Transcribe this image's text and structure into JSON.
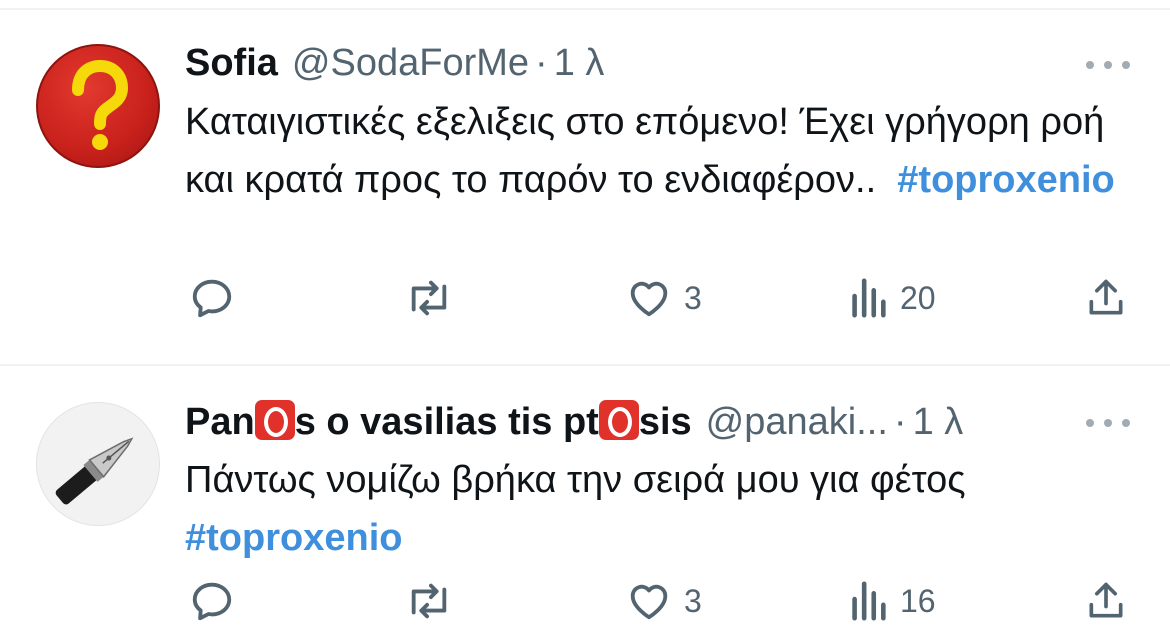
{
  "tweets": [
    {
      "name": "Sofia",
      "handle": "@SodaForMe",
      "separator": "·",
      "time": "1 λ",
      "text": "Καταιγιστικές εξελιξεις στο επόμενο! Έχει γρήγορη ροή και κρατά προς το παρόν το ενδιαφέρον..",
      "hashtag": "#toproxenio",
      "likes": "3",
      "views": "20"
    },
    {
      "name_parts": [
        "Pan",
        "s o vasilias tis pt",
        "sis"
      ],
      "handle": "@panaki...",
      "separator": "·",
      "time": "1 λ",
      "text": "Πάντως νομίζω βρήκα την σειρά μου για φέτος",
      "hashtag": "#toproxenio",
      "likes": "3",
      "views": "16"
    }
  ],
  "icons": {
    "avatar1": "question-mark-icon",
    "avatar2": "fountain-pen-icon",
    "badge": "red-o-emoji-icon"
  },
  "colors": {
    "hashtag": "#3f8fdc",
    "secondary_text": "#536471",
    "avatar1_bg": "#c8201b",
    "avatar1_symbol": "#f5d90a"
  }
}
